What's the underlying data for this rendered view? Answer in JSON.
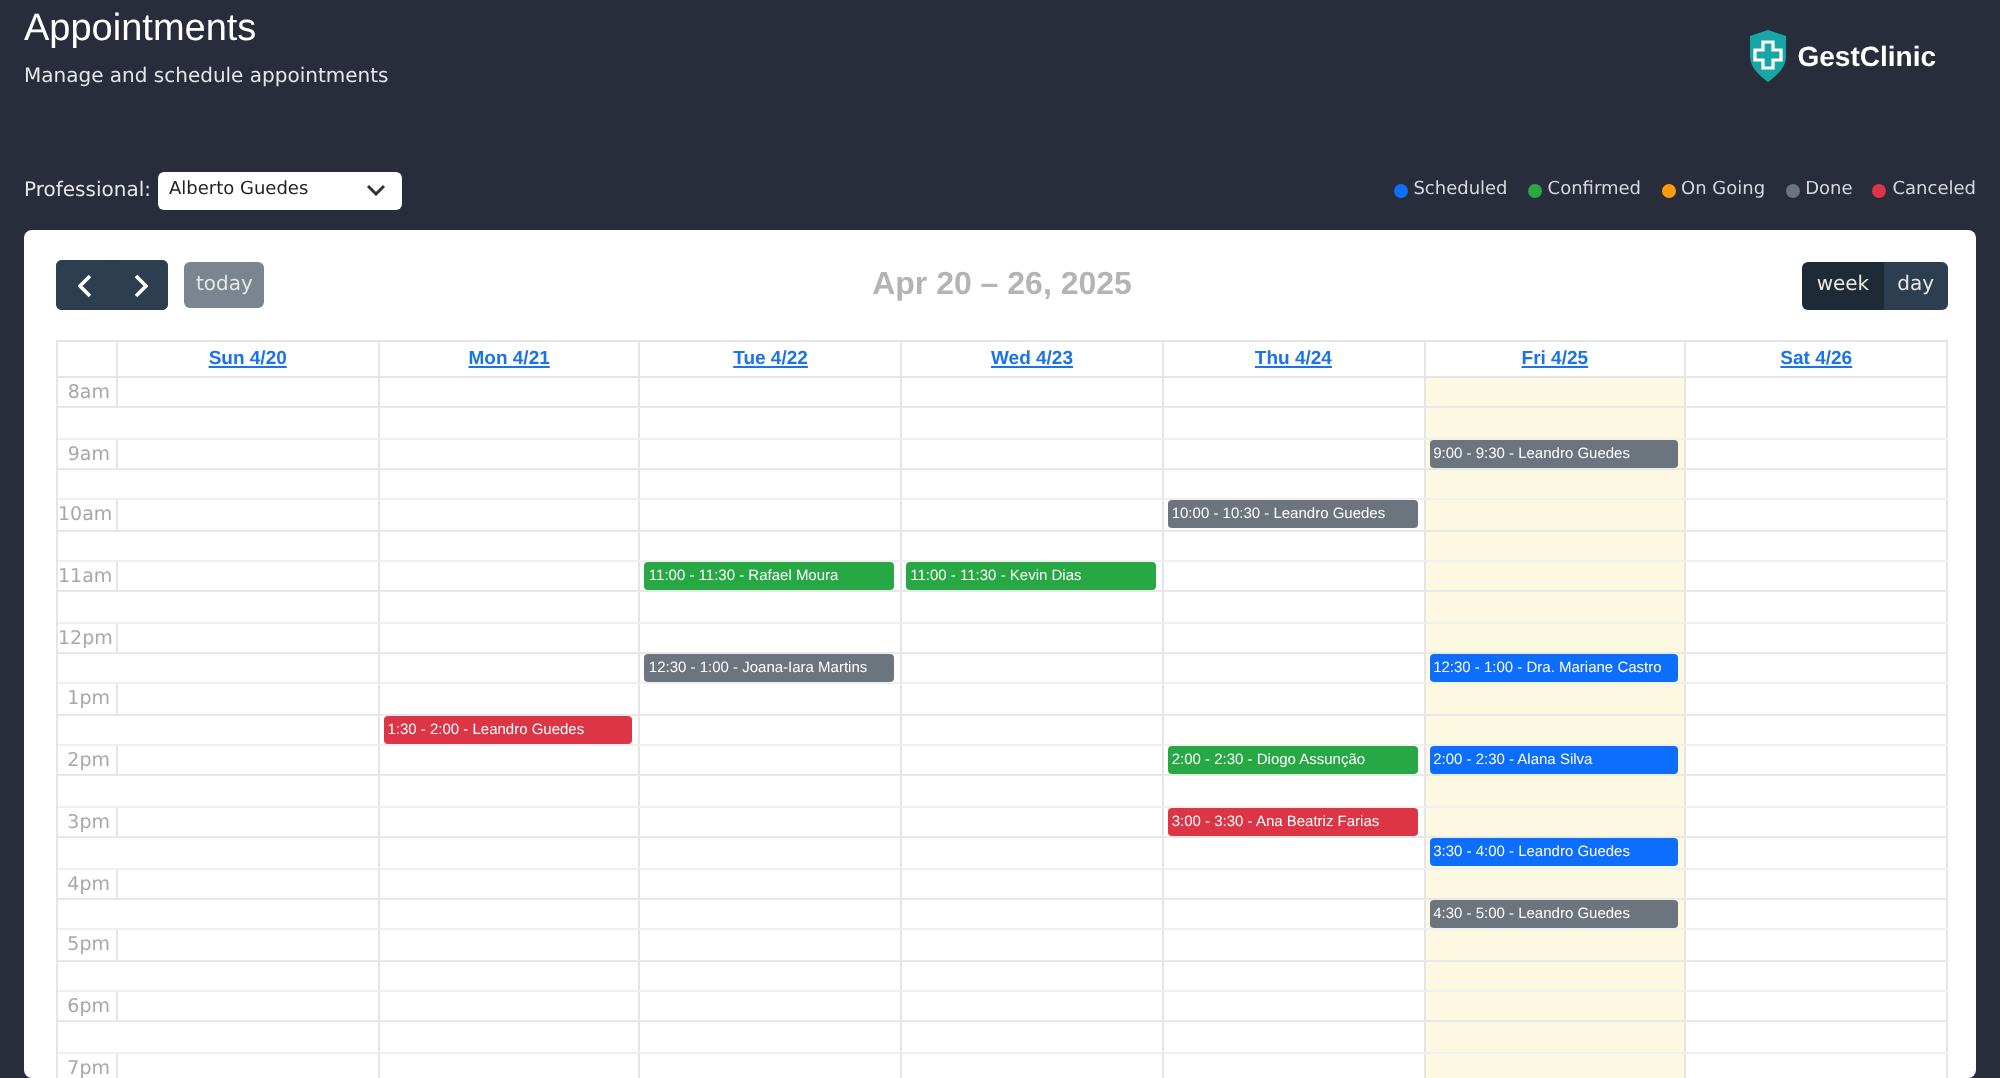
{
  "header": {
    "title": "Appointments",
    "subtitle": "Manage and schedule appointments",
    "logo_text": "GestClinic"
  },
  "filter": {
    "label": "Professional:",
    "value": "Alberto Guedes"
  },
  "legend": [
    {
      "label": "Scheduled",
      "color": "#0d6efd"
    },
    {
      "label": "Confirmed",
      "color": "#28a745"
    },
    {
      "label": "On Going",
      "color": "#fd9a0d"
    },
    {
      "label": "Done",
      "color": "#6c757d"
    },
    {
      "label": "Canceled",
      "color": "#dc3545"
    }
  ],
  "toolbar": {
    "today": "today",
    "range_title": "Apr 20 – 26, 2025",
    "views": [
      {
        "label": "week",
        "selected": true
      },
      {
        "label": "day",
        "selected": false
      }
    ]
  },
  "hours": [
    "8am",
    "9am",
    "10am",
    "11am",
    "12pm",
    "1pm",
    "2pm",
    "3pm",
    "4pm",
    "5pm",
    "6pm",
    "7pm"
  ],
  "days": [
    {
      "label": "Sun 4/20",
      "today": false
    },
    {
      "label": "Mon 4/21",
      "today": false,
      "events": [
        {
          "text": "1:30 - 2:00 - Leandro Guedes",
          "color": "#dc3545"
        }
      ]
    },
    {
      "label": "Tue 4/22",
      "today": false,
      "events": [
        {
          "text": "11:00 - 11:30 - Rafael Moura",
          "color": "#28a745"
        },
        {
          "text": "12:30 - 1:00 - Joana-Iara Martins",
          "color": "#6c757d"
        }
      ]
    },
    {
      "label": "Wed 4/23",
      "today": false,
      "events": [
        {
          "text": "11:00 - 11:30 - Kevin Dias",
          "color": "#28a745"
        }
      ]
    },
    {
      "label": "Thu 4/24",
      "today": false,
      "events": [
        {
          "text": "10:00 - 10:30 - Leandro Guedes",
          "color": "#6c757d"
        },
        {
          "text": "2:00 - 2:30 - Diogo Assunção",
          "color": "#28a745"
        },
        {
          "text": "3:00 - 3:30 - Ana Beatriz Farias",
          "color": "#dc3545"
        }
      ]
    },
    {
      "label": "Fri 4/25",
      "today": true,
      "events": [
        {
          "text": "9:00 - 9:30 - Leandro Guedes",
          "color": "#6c757d"
        },
        {
          "text": "12:30 - 1:00 - Dra. Mariane Castro",
          "color": "#0d6efd"
        },
        {
          "text": "2:00 - 2:30 - Alana Silva",
          "color": "#0d6efd"
        },
        {
          "text": "3:30 - 4:00 - Leandro Guedes",
          "color": "#0d6efd"
        },
        {
          "text": "4:30 - 5:00 - Leandro Guedes",
          "color": "#6c757d"
        }
      ]
    },
    {
      "label": "Sat 4/26",
      "today": false
    }
  ]
}
